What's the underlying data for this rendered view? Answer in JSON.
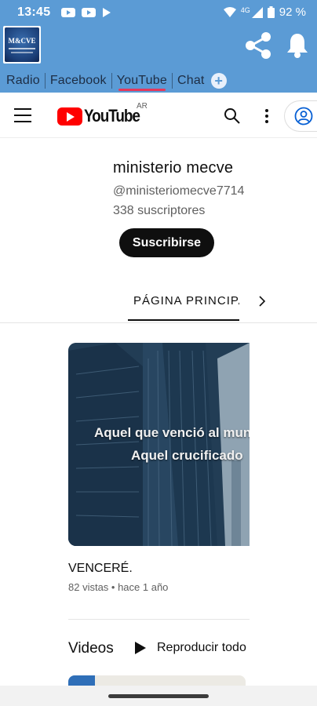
{
  "status_bar": {
    "time": "13:45",
    "network": "4G",
    "battery": "92 %"
  },
  "app": {
    "logo_text": "M&CVE",
    "tabs": [
      {
        "label": "Radio",
        "active": false
      },
      {
        "label": "Facebook",
        "active": false
      },
      {
        "label": "YouTube",
        "active": true
      },
      {
        "label": "Chat",
        "active": false
      }
    ],
    "accent_color": "#5b9bd5",
    "active_tab_color": "#e5395c"
  },
  "youtube_header": {
    "logo_text": "YouTube",
    "region": "AR"
  },
  "channel": {
    "name": "ministerio mecve",
    "handle": "@ministeriomecve7714",
    "subscribers": "338 suscriptores",
    "subscribe_label": "Suscribirse"
  },
  "channel_tabs": {
    "active_label": "PÁGINA PRINCIPAL"
  },
  "featured_video": {
    "overlay_line1": "Aquel que venció al mundo",
    "overlay_line2": "Aquel crucificado",
    "title": "VENCERÉ.",
    "meta": "82 vistas • hace 1 año"
  },
  "videos_section": {
    "title": "Videos",
    "play_all_label": "Reproducir todo"
  }
}
